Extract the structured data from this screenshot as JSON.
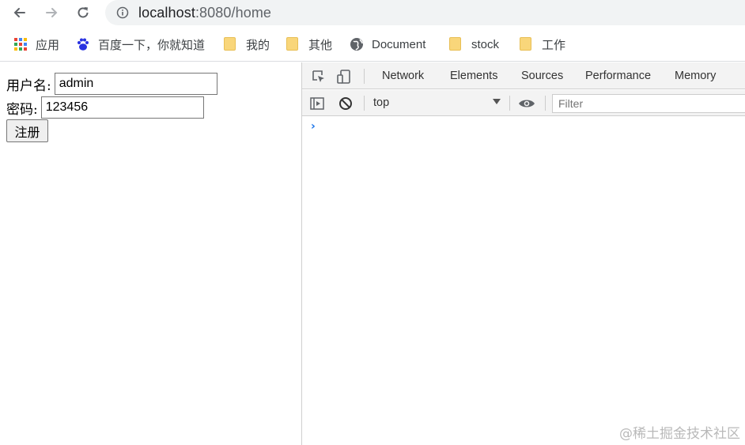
{
  "browser": {
    "url_host": "localhost",
    "url_rest": ":8080/home"
  },
  "bookmarks": [
    {
      "label": "应用",
      "icon": "apps-grid-icon"
    },
    {
      "label": "百度一下，你就知道",
      "icon": "baidu-paw-icon"
    },
    {
      "label": "我的",
      "icon": "folder-icon"
    },
    {
      "label": "其他",
      "icon": "folder-icon"
    },
    {
      "label": "Document",
      "icon": "globe-icon"
    },
    {
      "label": "stock",
      "icon": "folder-icon"
    },
    {
      "label": "工作",
      "icon": "folder-icon"
    }
  ],
  "form": {
    "username_label": "用户名:",
    "username_value": "admin",
    "password_label": "密码:",
    "password_value": "123456",
    "submit_label": "注册"
  },
  "devtools": {
    "tabs": [
      "Network",
      "Elements",
      "Sources",
      "Performance",
      "Memory"
    ],
    "context": "top",
    "filter_placeholder": "Filter",
    "prompt": "›"
  },
  "watermark": "@稀土掘金技术社区",
  "colors": {
    "folder": "#f9d67a",
    "prompt": "#1a73e8"
  }
}
